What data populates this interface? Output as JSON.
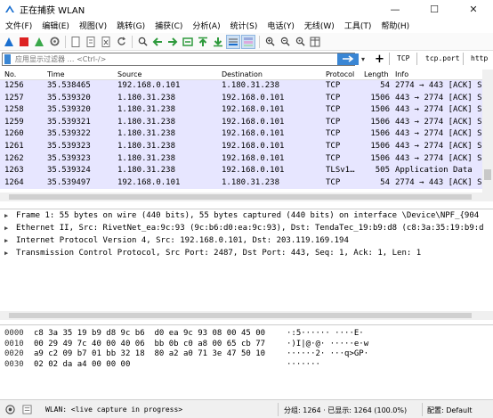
{
  "window": {
    "title": "正在捕获 WLAN",
    "minimize": "—",
    "maximize": "☐",
    "close": "✕"
  },
  "menu": [
    "文件(F)",
    "编辑(E)",
    "视图(V)",
    "跳转(G)",
    "捕获(C)",
    "分析(A)",
    "统计(S)",
    "电话(Y)",
    "无线(W)",
    "工具(T)",
    "帮助(H)"
  ],
  "filter": {
    "placeholder": "应用显示过滤器 … <Ctrl-/>",
    "buttons": [
      "TCP",
      "tcp.port",
      "http"
    ]
  },
  "packet_list": {
    "columns": [
      "No.",
      "Time",
      "Source",
      "Destination",
      "Protocol",
      "Length",
      "Info"
    ],
    "rows": [
      [
        "1256",
        "35.538465",
        "192.168.0.101",
        "1.180.31.238",
        "TCP",
        "54",
        "2774 → 443 [ACK] S"
      ],
      [
        "1257",
        "35.539320",
        "1.180.31.238",
        "192.168.0.101",
        "TCP",
        "1506",
        "443 → 2774 [ACK] S"
      ],
      [
        "1258",
        "35.539320",
        "1.180.31.238",
        "192.168.0.101",
        "TCP",
        "1506",
        "443 → 2774 [ACK] S"
      ],
      [
        "1259",
        "35.539321",
        "1.180.31.238",
        "192.168.0.101",
        "TCP",
        "1506",
        "443 → 2774 [ACK] S"
      ],
      [
        "1260",
        "35.539322",
        "1.180.31.238",
        "192.168.0.101",
        "TCP",
        "1506",
        "443 → 2774 [ACK] S"
      ],
      [
        "1261",
        "35.539323",
        "1.180.31.238",
        "192.168.0.101",
        "TCP",
        "1506",
        "443 → 2774 [ACK] S"
      ],
      [
        "1262",
        "35.539323",
        "1.180.31.238",
        "192.168.0.101",
        "TCP",
        "1506",
        "443 → 2774 [ACK] S"
      ],
      [
        "1263",
        "35.539324",
        "1.180.31.238",
        "192.168.0.101",
        "TLSv1…",
        "505",
        "Application Data"
      ],
      [
        "1264",
        "35.539497",
        "192.168.0.101",
        "1.180.31.238",
        "TCP",
        "54",
        "2774 → 443 [ACK] S"
      ]
    ]
  },
  "details": [
    "Frame 1: 55 bytes on wire (440 bits), 55 bytes captured (440 bits) on interface \\Device\\NPF_{904",
    "Ethernet II, Src: RivetNet_ea:9c:93 (9c:b6:d0:ea:9c:93), Dst: TendaTec_19:b9:d8 (c8:3a:35:19:b9:d",
    "Internet Protocol Version 4, Src: 192.168.0.101, Dst: 203.119.169.194",
    "Transmission Control Protocol, Src Port: 2487, Dst Port: 443, Seq: 1, Ack: 1, Len: 1"
  ],
  "bytes": [
    {
      "offset": "0000",
      "hex": "c8 3a 35 19 b9 d8 9c b6  d0 ea 9c 93 08 00 45 00",
      "ascii": "·:5······ ····E·"
    },
    {
      "offset": "0010",
      "hex": "00 29 49 7c 40 00 40 06  bb 0b c0 a8 00 65 cb 77",
      "ascii": "·)I|@·@· ·····e·w"
    },
    {
      "offset": "0020",
      "hex": "a9 c2 09 b7 01 bb 32 18  80 a2 a0 71 3e 47 50 10",
      "ascii": "······2· ···q>GP·"
    },
    {
      "offset": "0030",
      "hex": "02 02 da a4 00 00 00",
      "ascii": "·······"
    }
  ],
  "status": {
    "interface": "WLAN: <live capture in progress>",
    "packets": "分组: 1264 · 已显示: 1264 (100.0%)",
    "profile": "配置: Default"
  },
  "colors": {
    "row_bg": "#e7e6ff",
    "accent": "#3a86d4",
    "shark_fin": "#1a6fcf"
  }
}
